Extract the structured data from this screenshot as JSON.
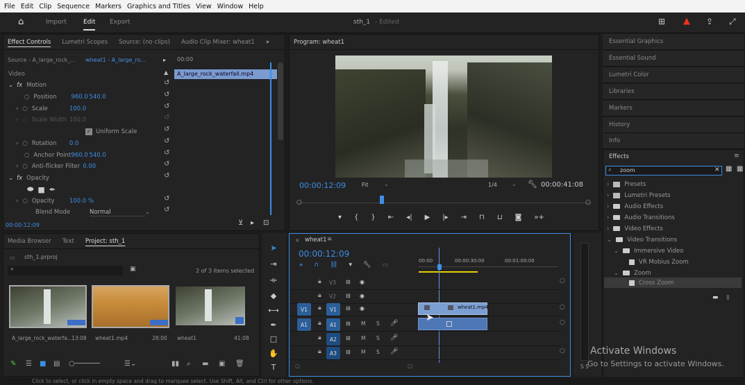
{
  "menu": [
    "File",
    "Edit",
    "Clip",
    "Sequence",
    "Markers",
    "Graphics and Titles",
    "View",
    "Window",
    "Help"
  ],
  "topbar": {
    "import": "Import",
    "edit": "Edit",
    "export": "Export",
    "title": "sth_1",
    "edited": "- Edited"
  },
  "effect_controls": {
    "tabs": [
      "Effect Controls",
      "Lumetri Scopes",
      "Source: (no clips)",
      "Audio Clip Mixer: wheat1"
    ],
    "source": "Source - A_large_rock_...",
    "sequence": "wheat1 - A_large_ro...",
    "timecode_start": "00:00",
    "clip_name": "A_large_rock_waterfall.mp4",
    "video_label": "Video",
    "motion": "Motion",
    "position_label": "Position",
    "position_x": "960.0",
    "position_y": "540.0",
    "scale_label": "Scale",
    "scale_val": "100.0",
    "scale_width_label": "Scale Width",
    "scale_width_val": "100.0",
    "uniform_scale": "Uniform Scale",
    "rotation_label": "Rotation",
    "rotation_val": "0.0",
    "anchor_label": "Anchor Point",
    "anchor_x": "960.0",
    "anchor_y": "540.0",
    "antiflicker_label": "Anti-flicker Filter",
    "antiflicker_val": "0.00",
    "opacity": "Opacity",
    "opacity_label": "Opacity",
    "opacity_val": "100.0 %",
    "blend_label": "Blend Mode",
    "blend_val": "Normal",
    "timecode": "00:00:12:09"
  },
  "program": {
    "title": "Program: wheat1",
    "timecode": "00:00:12:09",
    "fit": "Fit",
    "quality": "1/4",
    "duration": "00:00:41:08"
  },
  "right_panels": [
    "Essential Graphics",
    "Essential Sound",
    "Lumetri Color",
    "Libraries",
    "Markers",
    "History",
    "Info"
  ],
  "effects": {
    "title": "Effects",
    "search": "zoom",
    "items": [
      "Presets",
      "Lumetri Presets",
      "Audio Effects",
      "Audio Transitions",
      "Video Effects",
      "Video Transitions",
      "Immersive Video",
      "VR Mobius Zoom",
      "Zoom",
      "Cross Zoom"
    ]
  },
  "project": {
    "tabs": [
      "Media Browser",
      "Text",
      "Project: sth_1"
    ],
    "file": "sth_1.prproj",
    "selected": "2 of 3 items selected",
    "items": [
      {
        "name": "A_large_rock_waterfa...",
        "dur": "13:08"
      },
      {
        "name": "wheat1.mp4",
        "dur": "28:00"
      },
      {
        "name": "wheat1",
        "dur": "41:08"
      }
    ]
  },
  "timeline": {
    "title": "wheat1",
    "timecode": "00:00:12:09",
    "ruler": [
      "00:00",
      "00:00:30:00",
      "00:01:00:00"
    ],
    "tracks": [
      "V3",
      "V2",
      "V1",
      "A1",
      "A2",
      "A3"
    ],
    "v1": "V1",
    "a1": "A1",
    "clip": "wheat1.mp4"
  },
  "watermark": {
    "line1": "Activate Windows",
    "line2": "Go to Settings to activate Windows."
  },
  "status": "Click to select, or click in empty space and drag to marquee select. Use Shift, Alt, and Ctrl for other options."
}
